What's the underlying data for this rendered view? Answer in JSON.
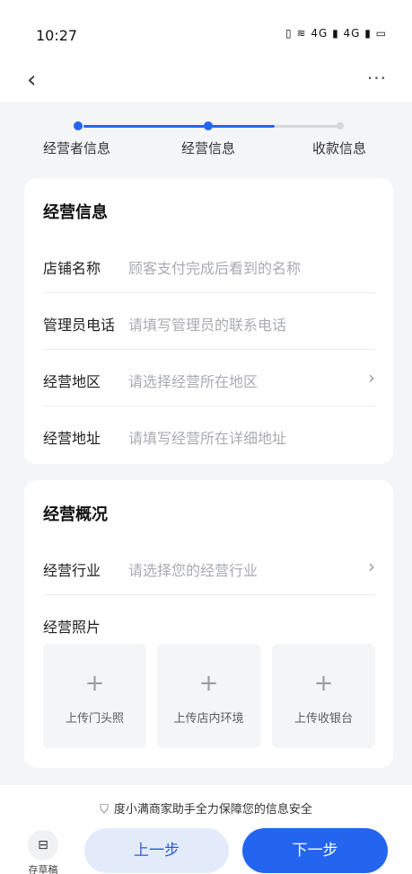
{
  "status_bar": {
    "time": "10:27",
    "icons": "▯ ≋ 4G ▮ 4G ▮ ▭"
  },
  "nav": {
    "back": "‹",
    "more": "···"
  },
  "steps": [
    {
      "label": "经营者信息",
      "state": "done"
    },
    {
      "label": "经营信息",
      "state": "current"
    },
    {
      "label": "收款信息",
      "state": "pending"
    }
  ],
  "business_info": {
    "title": "经营信息",
    "rows": [
      {
        "label": "店铺名称",
        "placeholder": "顾客支付完成后看到的名称",
        "chevron": ""
      },
      {
        "label": "管理员电话",
        "placeholder": "请填写管理员的联系电话",
        "chevron": ""
      },
      {
        "label": "经营地区",
        "placeholder": "请选择经营所在地区",
        "chevron": "›"
      },
      {
        "label": "经营地址",
        "placeholder": "请填写经营所在详细地址",
        "chevron": ""
      }
    ]
  },
  "business_overview": {
    "title": "经营概况",
    "industry": {
      "label": "经营行业",
      "placeholder": "请选择您的经营行业",
      "chevron": "›"
    },
    "photos_label": "经营照片",
    "photos": [
      {
        "plus": "+",
        "label": "上传门头照"
      },
      {
        "plus": "+",
        "label": "上传店内环境"
      },
      {
        "plus": "+",
        "label": "上传收银台"
      }
    ]
  },
  "footer": {
    "secure_text": "度小满商家助手全力保障您的信息安全",
    "draft_label": "存草稿",
    "prev_label": "上一步",
    "next_label": "下一步"
  },
  "colors": {
    "accent": "#2465f0",
    "accent_light": "#e3ebfb",
    "pending": "#d6d8dc"
  }
}
